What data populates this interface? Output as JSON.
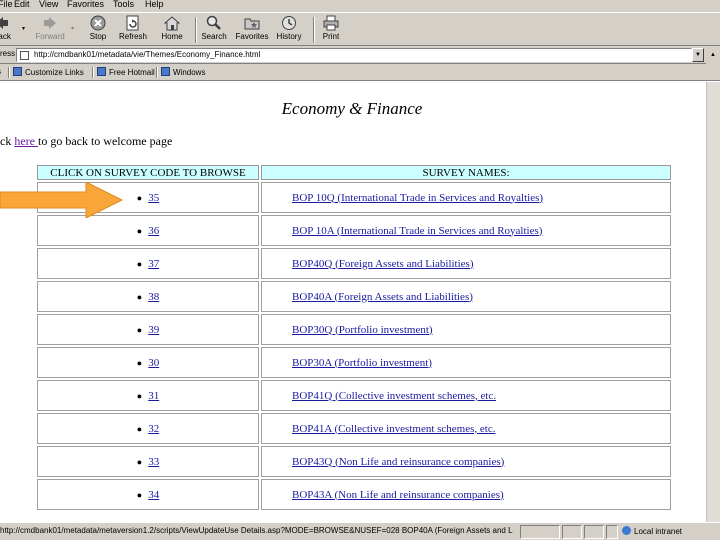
{
  "menu": [
    "File",
    "Edit",
    "View",
    "Favorites",
    "Tools",
    "Help"
  ],
  "toolbar": {
    "back": "Back",
    "forward": "Forward",
    "stop": "Stop",
    "refresh": "Refresh",
    "home": "Home",
    "search": "Search",
    "favorites": "Favorites",
    "history": "History",
    "print": "Print"
  },
  "address": {
    "label": "ress",
    "url": "http://cmdbank01/metadata/vie/Themes/Economy_Finance.html"
  },
  "links": [
    "Customize Links",
    "Free Hotmail",
    "Windows"
  ],
  "page": {
    "title": "Economy & Finance",
    "back_prefix": "ck ",
    "back_link": "here ",
    "back_suffix": "to go back to welcome page"
  },
  "table": {
    "headers": [
      "CLICK ON SURVEY CODE TO BROWSE",
      "SURVEY NAMES:"
    ],
    "rows": [
      {
        "code": "35",
        "name": "BOP 10Q (International Trade in Services and Royalties)"
      },
      {
        "code": "36",
        "name": "BOP 10A (International Trade in Services and Royalties)"
      },
      {
        "code": "37",
        "name": "BOP40Q (Foreign Assets and Liabilities)"
      },
      {
        "code": "38",
        "name": "BOP40A (Foreign Assets and Liabilities)"
      },
      {
        "code": "39",
        "name": "BOP30Q (Portfolio investment)"
      },
      {
        "code": "30",
        "name": "BOP30A (Portfolio investment)"
      },
      {
        "code": "31",
        "name": "BOP41Q (Collective investment schemes, etc."
      },
      {
        "code": "32",
        "name": "BOP41A (Collective investment schemes, etc."
      },
      {
        "code": "33",
        "name": "BOP43Q (Non Life and reinsurance companies)"
      },
      {
        "code": "34",
        "name": "BOP43A (Non Life and reinsurance companies)"
      }
    ]
  },
  "status": {
    "text": "http://cmdbank01/metadata/metaversion1.2/scripts/ViewUpdateUse Details.asp?MODE=BROWSE&NUSEF=028 BOP40A (Foreign Assets and L",
    "zone": "Local intranet"
  },
  "colors": {
    "chrome": "#d4d0c8",
    "header_cell": "#ccffff",
    "link": "#1a1aa0",
    "visited_link": "#6a1a9a",
    "arrow": "#f7a637"
  }
}
